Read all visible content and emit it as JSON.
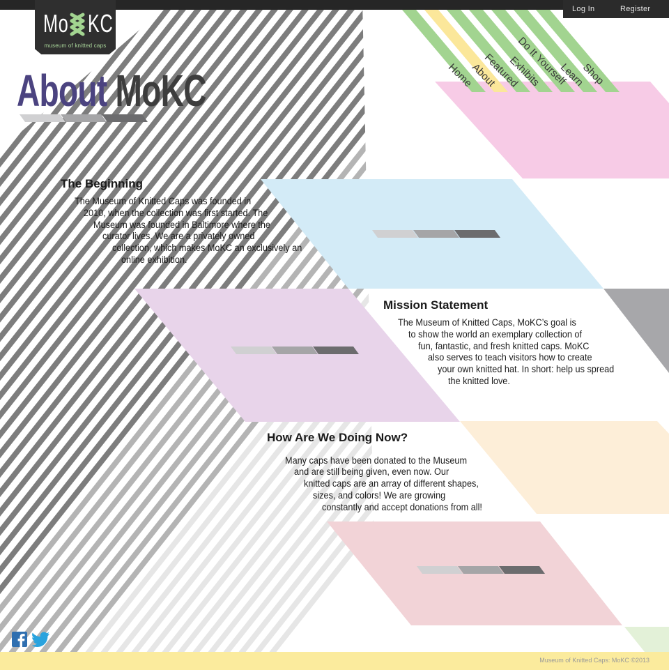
{
  "colors": {
    "stripe_gray_light": "#e6e6e6",
    "stripe_gray_mid": "#b4b4b4",
    "stripe_gray_dark": "#7d7d7d",
    "nav_green": "#a2d490",
    "nav_yellow": "#fbe79a",
    "panel_pink": "#f7cbe6",
    "panel_blue": "#d3ebf7",
    "panel_purple": "#e8d4ea",
    "panel_peach": "#fdeed8",
    "panel_rose": "#f2d3d7",
    "panel_gray": "#a7a7aa",
    "panel_mint": "#e3f1d8",
    "title_purple": "#4b4380",
    "dark": "#2f2f2f"
  },
  "account": {
    "login": "Log In",
    "register": "Register"
  },
  "logo": {
    "mo": "Mo",
    "kc": "KC",
    "tagline": "museum of knitted caps"
  },
  "page_title": {
    "part1": "About",
    "part2": "MoKC"
  },
  "nav": [
    {
      "label": "Home",
      "active": false
    },
    {
      "label": "About",
      "active": true
    },
    {
      "label": "Featured",
      "active": false
    },
    {
      "label": "Exhibits",
      "active": false
    },
    {
      "label": "Do It Yourself",
      "active": false
    },
    {
      "label": "Learn",
      "active": false
    },
    {
      "label": "Shop",
      "active": false
    }
  ],
  "sections": {
    "beginning": {
      "title": "The Beginning",
      "lines": [
        "The Museum of Knitted Caps was founded in",
        "2010, when the collection was first started. The",
        "Museum was founded in Baltimore where the",
        "curator lives. We are a privately owned",
        "collection, which makes MoKC an exclusively an",
        "online exhibition."
      ]
    },
    "mission": {
      "title": "Mission Statement",
      "lines": [
        "The Museum of Knitted Caps, MoKC’s goal is",
        "to show the world an exemplary collection of",
        "fun, fantastic, and fresh knitted caps. MoKC",
        "also serves to teach visitors how to create",
        "your own knitted hat. In short: help us spread",
        "the knitted love."
      ]
    },
    "now": {
      "title": "How Are We Doing Now?",
      "lines": [
        "Many caps have been donated to the Museum",
        "and are still being given, even now. Our",
        "knitted caps are an array of different shapes,",
        "sizes, and colors! We are growing",
        "constantly and accept donations from all!"
      ]
    }
  },
  "social": [
    "facebook-icon",
    "twitter-icon"
  ],
  "footer": {
    "copyright": "Museum of Knitted Caps: MoKC ©2013"
  }
}
